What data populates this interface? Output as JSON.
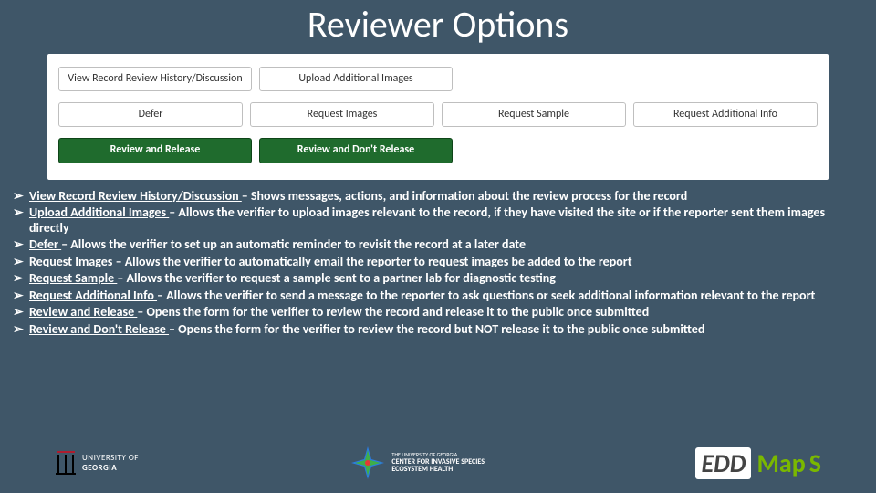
{
  "title": "Reviewer Options",
  "panel": {
    "row1": [
      {
        "label": "View Record Review History/Discussion"
      },
      {
        "label": "Upload Additional Images"
      }
    ],
    "row2": [
      {
        "label": "Defer"
      },
      {
        "label": "Request Images"
      },
      {
        "label": "Request Sample"
      },
      {
        "label": "Request Additional Info"
      }
    ],
    "row3": [
      {
        "label": "Review and Release"
      },
      {
        "label": "Review and Don't Release"
      }
    ]
  },
  "bullets": [
    {
      "term": "View Record Review History/Discussion",
      "desc": " – Shows messages, actions, and information about the review process for the record"
    },
    {
      "term": "Upload Additional Images",
      "desc": " – Allows the verifier to upload images relevant to the record, if they have visited the site or if the reporter sent them images directly"
    },
    {
      "term": "Defer",
      "desc": " – Allows the verifier to set up an automatic reminder to revisit the record at a later date"
    },
    {
      "term": "Request Images",
      "desc": " – Allows the verifier to automatically email the reporter to request images be added to the report"
    },
    {
      "term": "Request Sample",
      "desc": " – Allows the verifier to request a sample sent to a partner lab for diagnostic testing"
    },
    {
      "term": "Request Additional Info",
      "desc": " – Allows the verifier to send a message to the reporter to ask questions or seek additional information relevant to the report"
    },
    {
      "term": "Review and Release",
      "desc": " – Opens the form for the verifier to review the record and release it to the public once submitted"
    },
    {
      "term": "Review and Don't Release",
      "desc": " – Opens the form for the verifier to review the record but NOT release it to the public once submitted"
    }
  ],
  "logos": {
    "uga_line1": "UNIVERSITY OF",
    "uga_line2": "GEORGIA",
    "cise_line1": "THE UNIVERSITY OF GEORGIA",
    "cise_line2": "CENTER FOR INVASIVE SPECIES",
    "cise_line3": "ECOSYSTEM HEALTH",
    "edd_e": "EDD",
    "edd_map": "Map",
    "edd_s": "S"
  }
}
